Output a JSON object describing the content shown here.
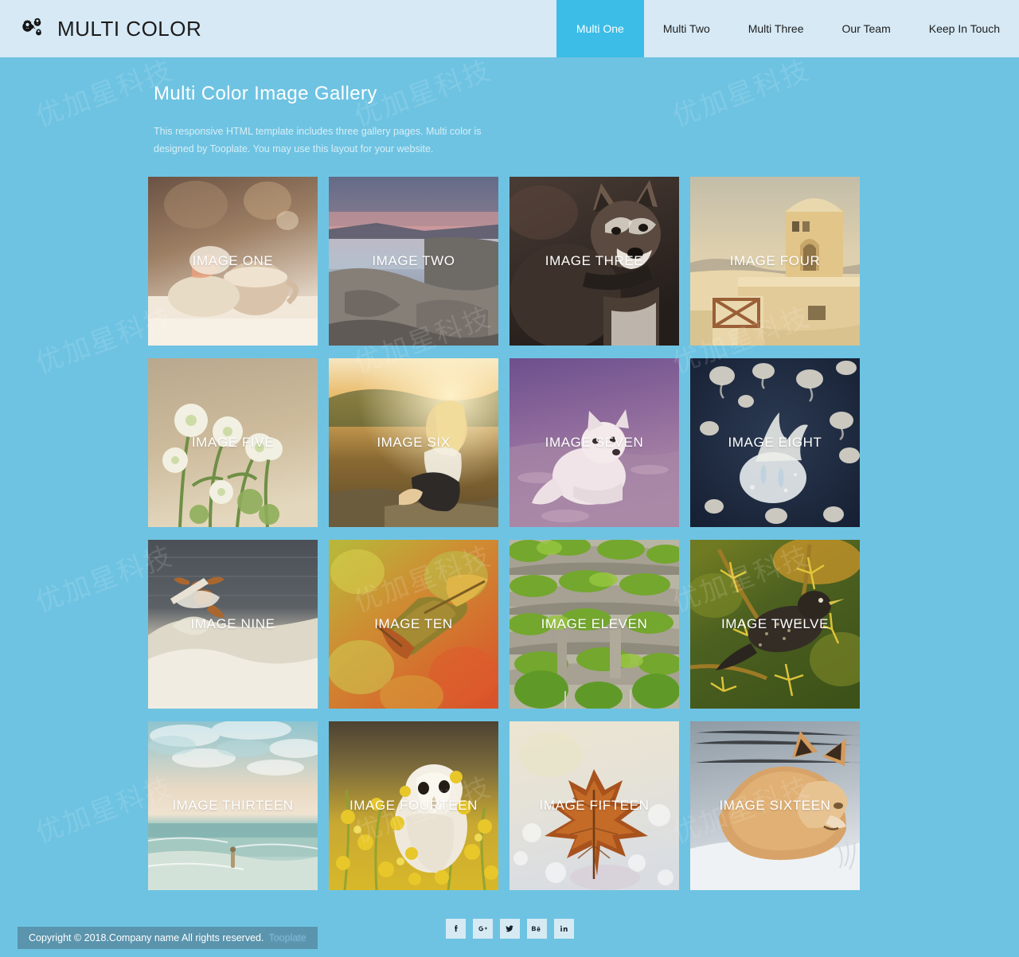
{
  "header": {
    "brand_name": "MULTI COLOR",
    "brand_icon": "cogs-icon",
    "nav": [
      {
        "label": "Multi One",
        "active": true
      },
      {
        "label": "Multi Two",
        "active": false
      },
      {
        "label": "Multi Three",
        "active": false
      },
      {
        "label": "Our Team",
        "active": false
      },
      {
        "label": "Keep In Touch",
        "active": false
      }
    ]
  },
  "intro": {
    "title": "Multi Color Image Gallery",
    "description": "This responsive HTML template includes three gallery pages. Multi color is designed by Tooplate. You may use this layout for your website."
  },
  "gallery": {
    "items": [
      {
        "label": "IMAGE ONE",
        "subject": "coffee-cup-and-book"
      },
      {
        "label": "IMAGE TWO",
        "subject": "rocky-coast-at-sunset"
      },
      {
        "label": "IMAGE THREE",
        "subject": "husky-dog"
      },
      {
        "label": "IMAGE FOUR",
        "subject": "sandstone-windmill-building"
      },
      {
        "label": "IMAGE FIVE",
        "subject": "white-flowers"
      },
      {
        "label": "IMAGE SIX",
        "subject": "woman-at-golden-sunset"
      },
      {
        "label": "IMAGE SEVEN",
        "subject": "arctic-fox-on-snow"
      },
      {
        "label": "IMAGE EIGHT",
        "subject": "jellyfish-underwater"
      },
      {
        "label": "IMAGE NINE",
        "subject": "surfer-on-wave"
      },
      {
        "label": "IMAGE TEN",
        "subject": "autumn-maple-leaves"
      },
      {
        "label": "IMAGE ELEVEN",
        "subject": "green-terraced-building"
      },
      {
        "label": "IMAGE TWELVE",
        "subject": "starling-on-yellow-branch"
      },
      {
        "label": "IMAGE THIRTEEN",
        "subject": "person-in-ocean-beach"
      },
      {
        "label": "IMAGE FOURTEEN",
        "subject": "barn-owl-in-yellow-flowers"
      },
      {
        "label": "IMAGE FIFTEEN",
        "subject": "maple-leaf-on-snow"
      },
      {
        "label": "IMAGE SIXTEEN",
        "subject": "sleeping-red-fox"
      }
    ]
  },
  "footer": {
    "social": [
      {
        "name": "facebook",
        "glyph": "f"
      },
      {
        "name": "google-plus",
        "glyph": "G+"
      },
      {
        "name": "twitter",
        "glyph": "bird"
      },
      {
        "name": "behance",
        "glyph": "Be"
      },
      {
        "name": "linkedin",
        "glyph": "in"
      }
    ],
    "copyright": "Copyright © 2018.Company name All rights reserved.",
    "credit_link": "Tooplate"
  },
  "watermark": {
    "text": "优加星科技"
  },
  "colors": {
    "page_background": "#6ec3e2",
    "header_background": "#d6e9f5",
    "active_nav": "#3bbde8",
    "social_tile": "#d6eaf4"
  }
}
